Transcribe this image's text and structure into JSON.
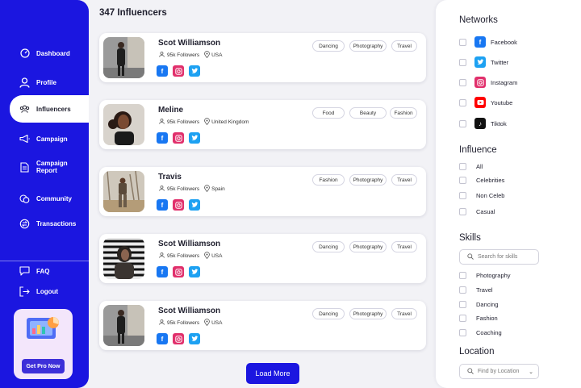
{
  "sidebar": {
    "nav": [
      {
        "label": "Dashboard",
        "icon": "dashboard-gauge-icon"
      },
      {
        "label": "Profile",
        "icon": "user-icon"
      },
      {
        "label": "Influencers",
        "icon": "users-group-icon",
        "active": true
      },
      {
        "label": "Campaign",
        "icon": "megaphone-icon"
      },
      {
        "label": "Campaign\nReport",
        "icon": "document-icon"
      },
      {
        "label": "Community",
        "icon": "community-icon"
      },
      {
        "label": "Transactions",
        "icon": "transactions-icon"
      }
    ],
    "bottom": [
      {
        "label": "FAQ",
        "icon": "faq-icon"
      },
      {
        "label": "Logout",
        "icon": "logout-icon"
      }
    ],
    "pro_button": "Get Pro Now"
  },
  "main": {
    "title": "347 Influencers",
    "load_more": "Load More",
    "influencers": [
      {
        "name": "Scot Williamson",
        "followers": "95k Followers",
        "location": "USA",
        "tags": [
          "Dancing",
          "Photography",
          "Travel"
        ]
      },
      {
        "name": "Meline",
        "followers": "95k Followers",
        "location": "United Kingdom",
        "tags": [
          "Food",
          "Beauty",
          "Fashion"
        ]
      },
      {
        "name": "Travis",
        "followers": "95k Followers",
        "location": "Spain",
        "tags": [
          "Fashion",
          "Photography",
          "Travel"
        ]
      },
      {
        "name": "Scot Williamson",
        "followers": "95k Followers",
        "location": "USA",
        "tags": [
          "Dancing",
          "Photography",
          "Travel"
        ]
      },
      {
        "name": "Scot Williamson",
        "followers": "95k Followers",
        "location": "USA",
        "tags": [
          "Dancing",
          "Photography",
          "Travel"
        ]
      }
    ]
  },
  "filters": {
    "networks_title": "Networks",
    "networks": [
      {
        "label": "Facebook",
        "icon": "facebook-icon",
        "color": "#1877f2"
      },
      {
        "label": "Twitter",
        "icon": "twitter-icon",
        "color": "#1da1f2"
      },
      {
        "label": "Instagram",
        "icon": "instagram-icon",
        "color": "#e1306c"
      },
      {
        "label": "Youtube",
        "icon": "youtube-icon",
        "color": "#ff0000"
      },
      {
        "label": "Tiktok",
        "icon": "tiktok-icon",
        "color": "#111111"
      }
    ],
    "influence_title": "Influence",
    "influence": [
      "All",
      "Celebrities",
      "Non Celeb",
      "Casual"
    ],
    "skills_title": "Skills",
    "skills_search_placeholder": "Search for skills",
    "skills": [
      "Photography",
      "Travel",
      "Dancing",
      "Fashion",
      "Coaching"
    ],
    "location_title": "Location",
    "location_placeholder": "Find by Location"
  },
  "colors": {
    "accent": "#1b16e0",
    "page_bg": "#f2f2f6"
  }
}
